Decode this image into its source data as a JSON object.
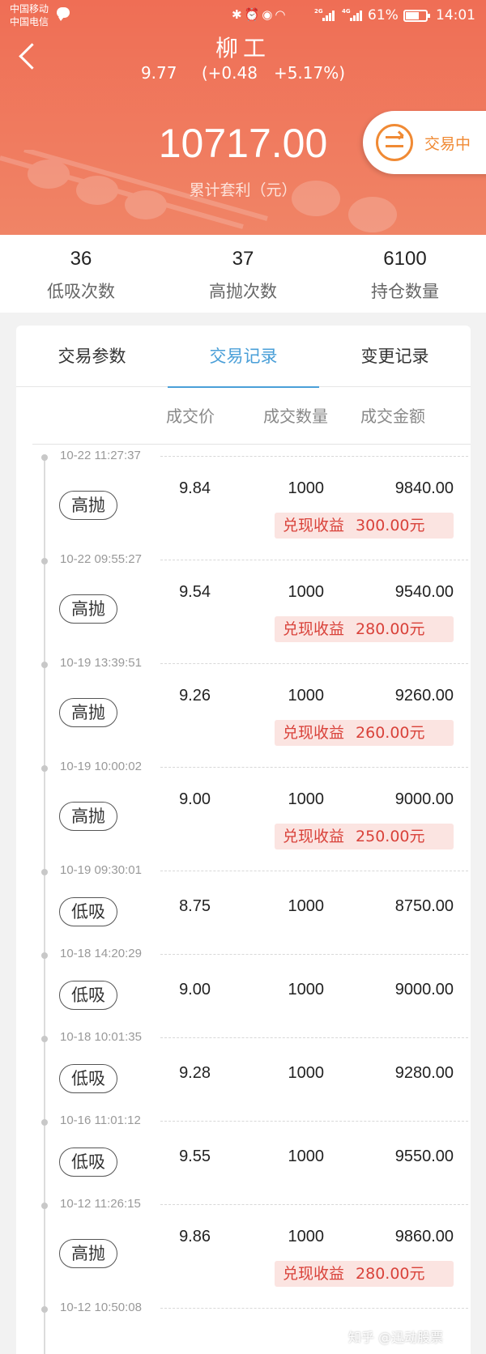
{
  "status_bar": {
    "carrier_1": "中国移动",
    "carrier_2": "中国电信",
    "sig1_label": "2G",
    "sig2_label": "4G",
    "battery": "61%",
    "time": "14:01"
  },
  "header": {
    "stock_name": "柳工",
    "price": "9.77",
    "change": "(+0.48",
    "change_pct": "+5.17%)",
    "profit_value": "10717.00",
    "profit_label": "累计套利（元）",
    "trade_status": "交易中",
    "accent": "#ef6e55",
    "status_color": "#f08a34"
  },
  "stats": [
    {
      "value": "36",
      "label": "低吸次数"
    },
    {
      "value": "37",
      "label": "高抛次数"
    },
    {
      "value": "6100",
      "label": "持仓数量"
    }
  ],
  "tabs": [
    {
      "label": "交易参数",
      "active": false
    },
    {
      "label": "交易记录",
      "active": true
    },
    {
      "label": "变更记录",
      "active": false
    }
  ],
  "columns": {
    "price": "成交价",
    "qty": "成交数量",
    "amount": "成交金额"
  },
  "profit_prefix": "兑现收益",
  "records": [
    {
      "time": "10-22 11:27:37",
      "tag": "高抛",
      "price": "9.84",
      "qty": "1000",
      "amount": "9840.00",
      "profit": "300.00元"
    },
    {
      "time": "10-22 09:55:27",
      "tag": "高抛",
      "price": "9.54",
      "qty": "1000",
      "amount": "9540.00",
      "profit": "280.00元"
    },
    {
      "time": "10-19 13:39:51",
      "tag": "高抛",
      "price": "9.26",
      "qty": "1000",
      "amount": "9260.00",
      "profit": "260.00元"
    },
    {
      "time": "10-19 10:00:02",
      "tag": "高抛",
      "price": "9.00",
      "qty": "1000",
      "amount": "9000.00",
      "profit": "250.00元"
    },
    {
      "time": "10-19 09:30:01",
      "tag": "低吸",
      "price": "8.75",
      "qty": "1000",
      "amount": "8750.00",
      "profit": null
    },
    {
      "time": "10-18 14:20:29",
      "tag": "低吸",
      "price": "9.00",
      "qty": "1000",
      "amount": "9000.00",
      "profit": null
    },
    {
      "time": "10-18 10:01:35",
      "tag": "低吸",
      "price": "9.28",
      "qty": "1000",
      "amount": "9280.00",
      "profit": null
    },
    {
      "time": "10-16 11:01:12",
      "tag": "低吸",
      "price": "9.55",
      "qty": "1000",
      "amount": "9550.00",
      "profit": null
    },
    {
      "time": "10-12 11:26:15",
      "tag": "高抛",
      "price": "9.86",
      "qty": "1000",
      "amount": "9860.00",
      "profit": "280.00元"
    },
    {
      "time": "10-12 10:50:08",
      "tag": "",
      "price": "",
      "qty": "",
      "amount": "",
      "profit": null
    }
  ],
  "watermark": "知乎 @迅动股票"
}
